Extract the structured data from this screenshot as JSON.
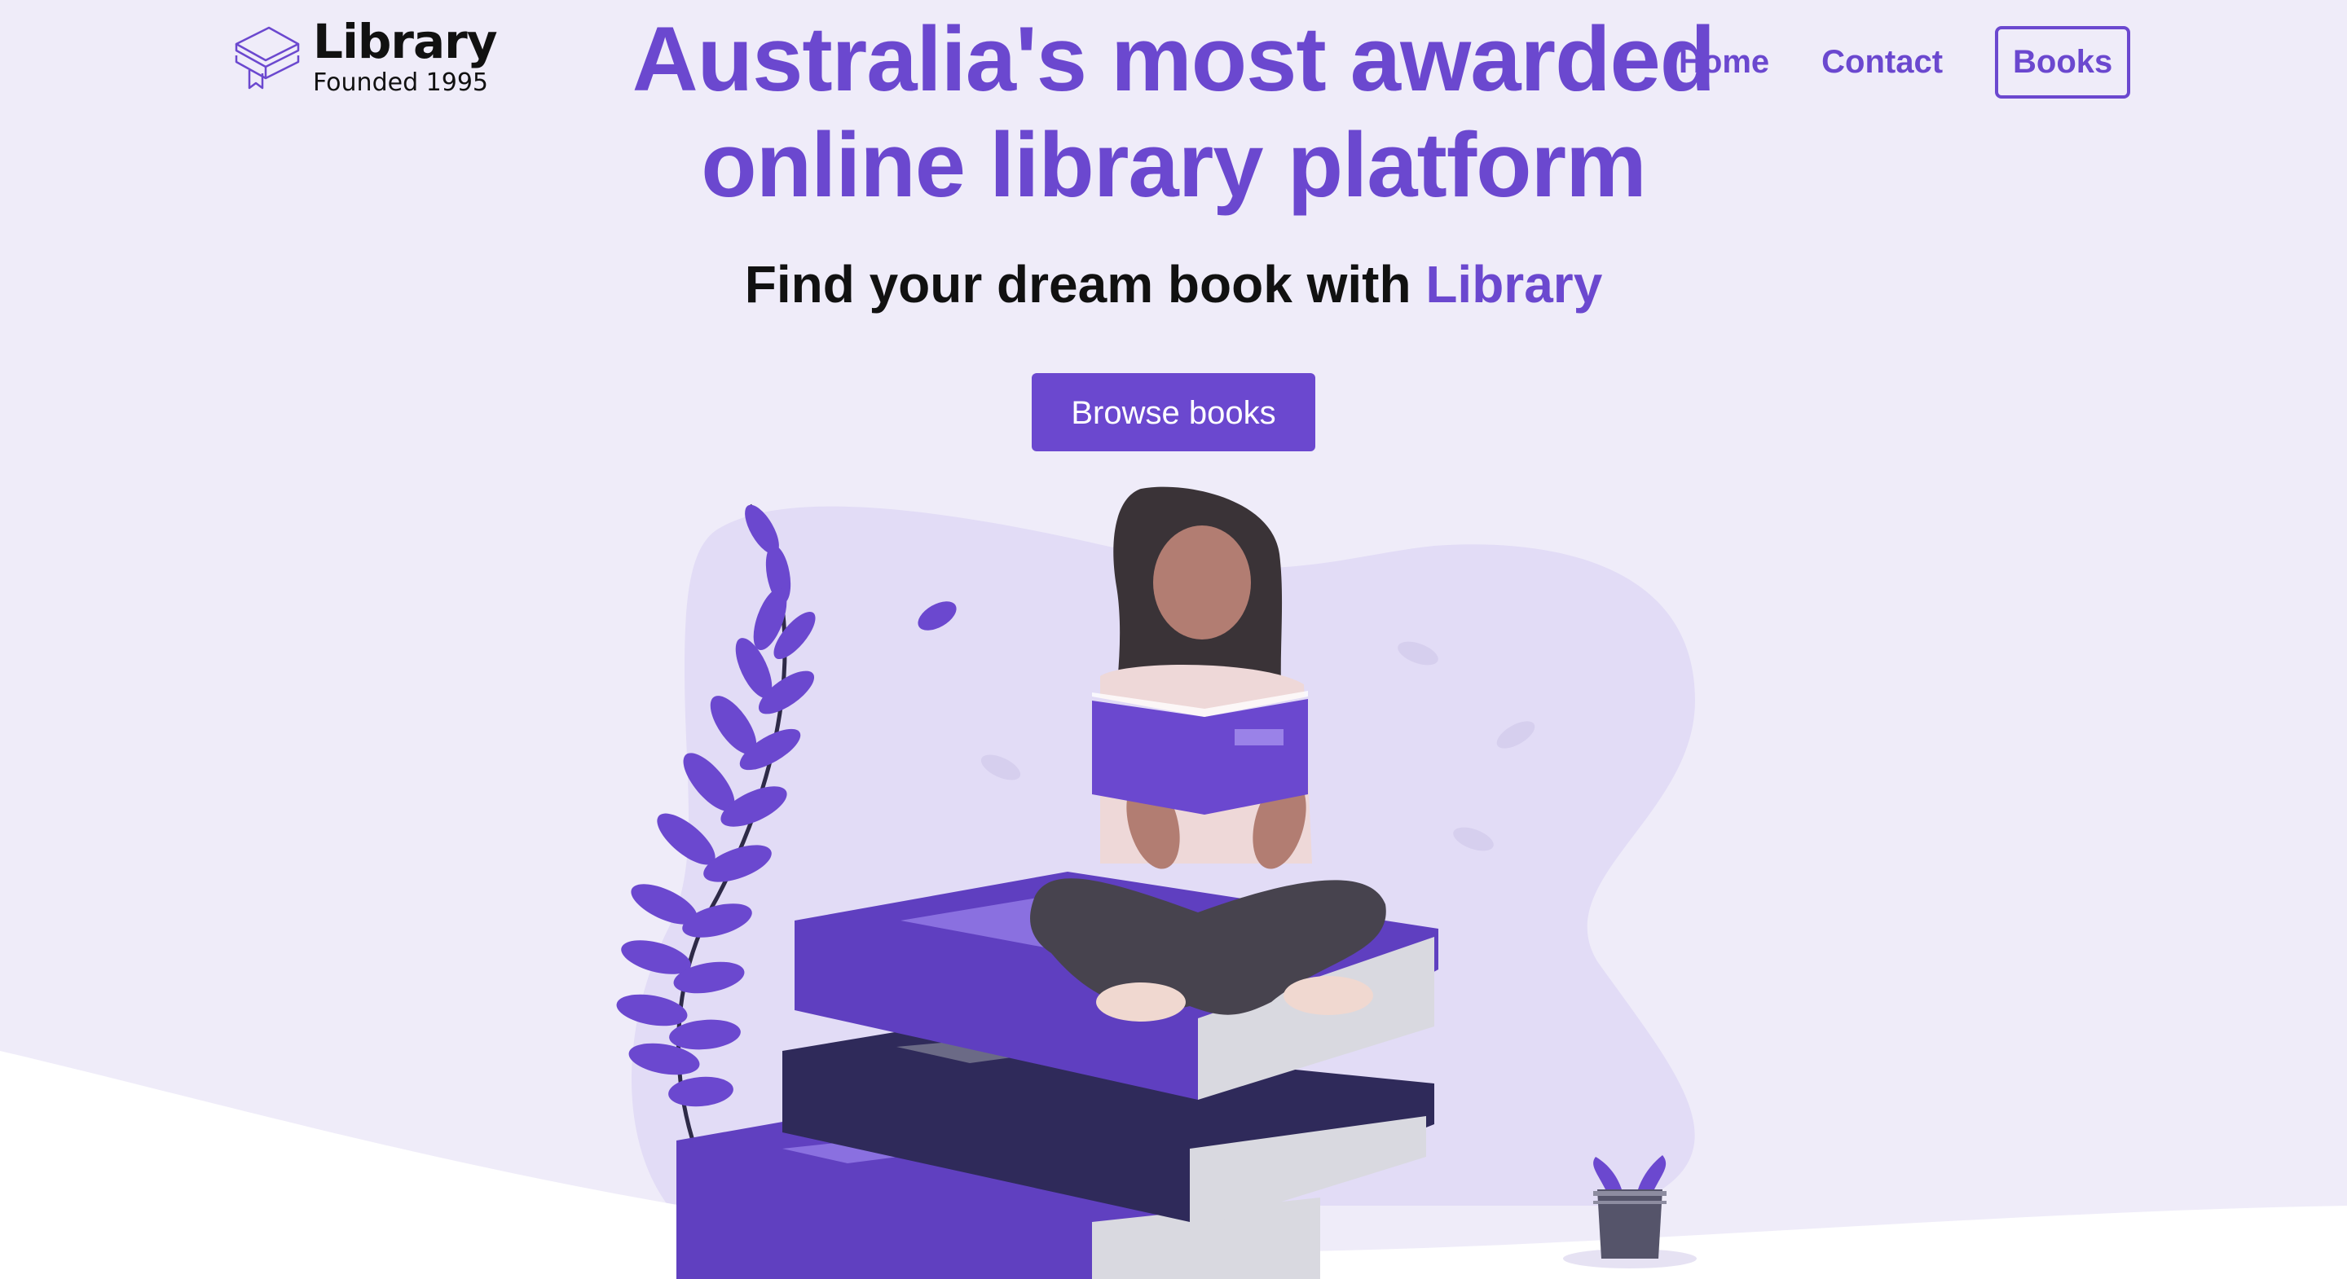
{
  "logo": {
    "name": "Library",
    "tagline": "Founded 1995",
    "icon": "stacked-books-icon"
  },
  "hero": {
    "headline_line1": "Australia's most awarded",
    "headline_line2": "online library platform",
    "subhead_prefix": "Find your dream book with ",
    "subhead_accent": "Library",
    "cta_label": "Browse books"
  },
  "nav": {
    "items": [
      {
        "label": "Home"
      },
      {
        "label": "Contact"
      },
      {
        "label": "Books"
      }
    ]
  },
  "colors": {
    "accent": "#6b48cf",
    "background": "#efecf9",
    "blob": "#e2dcf6",
    "text": "#111111"
  }
}
